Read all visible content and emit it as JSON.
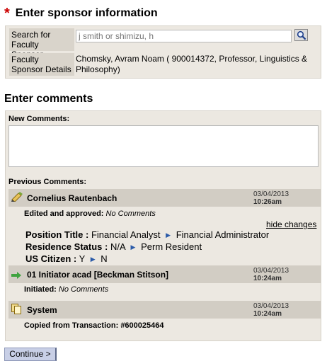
{
  "sponsor_section": {
    "title": "Enter sponsor information",
    "required_marker": "*",
    "search_label": "Search for Faculty Sponsor",
    "search_placeholder": "j smith or shimizu, h",
    "search_value": "",
    "search_button_icon": "magnifier-icon",
    "details_label": "Faculty Sponsor Details",
    "details_value": "Chomsky, Avram Noam ( 900014372, Professor, Linguistics & Philosophy)"
  },
  "comments_section": {
    "title": "Enter comments",
    "new_label": "New Comments:",
    "new_value": "",
    "previous_label": "Previous Comments:",
    "entries": [
      {
        "icon": "pencil-edit-icon",
        "name": "Cornelius Rautenbach",
        "date": "03/04/2013",
        "time": "10:26am",
        "action": "Edited and approved:",
        "comment": "No Comments",
        "hide_link": "hide changes",
        "changes": [
          {
            "field": "Position Title :",
            "from": "Financial Analyst",
            "to": "Financial Administrator"
          },
          {
            "field": "Residence Status :",
            "from": "N/A",
            "to": "Perm Resident"
          },
          {
            "field": "US Citizen :",
            "from": "Y",
            "to": "N"
          }
        ]
      },
      {
        "icon": "green-arrow-icon",
        "name": "01 Initiator acad [Beckman Stitson]",
        "date": "03/04/2013",
        "time": "10:24am",
        "action": "Initiated:",
        "comment": "No Comments"
      },
      {
        "icon": "copy-document-icon",
        "name": "System",
        "date": "03/04/2013",
        "time": "10:24am",
        "action": "Copied from Transaction:",
        "comment": "#600025464"
      }
    ]
  },
  "continue_label": "Continue >",
  "colors": {
    "required": "#cc0000",
    "panel_bg": "#ece8e1",
    "header_bg": "#d2cdc4",
    "button_bg": "#c8cfe6",
    "arrow": "#2a5aa8"
  }
}
